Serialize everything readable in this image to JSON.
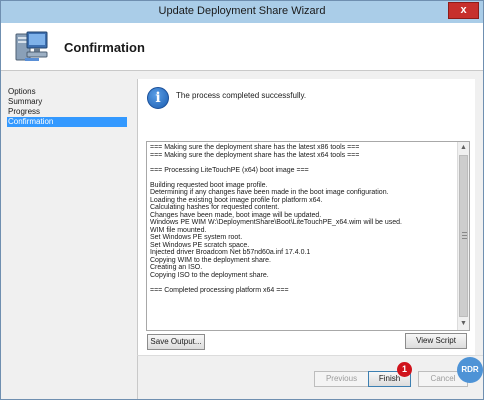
{
  "window": {
    "title": "Update Deployment Share Wizard",
    "close_label": "x"
  },
  "header": {
    "title": "Confirmation",
    "icon": "computer-wizard-icon"
  },
  "sidebar": {
    "items": [
      {
        "label": "Options",
        "active": false
      },
      {
        "label": "Summary",
        "active": false
      },
      {
        "label": "Progress",
        "active": false
      },
      {
        "label": "Confirmation",
        "active": true
      }
    ]
  },
  "content": {
    "info_icon_glyph": "i",
    "success_message": "The process completed successfully.",
    "log_lines": [
      "=== Making sure the deployment share has the latest x86 tools ===",
      "=== Making sure the deployment share has the latest x64 tools ===",
      "",
      "=== Processing LiteTouchPE (x64) boot image ===",
      "",
      "Building requested boot image profile.",
      "Determining if any changes have been made in the boot image configuration.",
      "Loading the existing boot image profile for platform x64.",
      "Calculating hashes for requested content.",
      "Changes have been made, boot image will be updated.",
      "Windows PE WIM W:\\DeploymentShare\\Boot\\LiteTouchPE_x64.wim will be used.",
      "WIM file mounted.",
      "Set Windows PE system root.",
      "Set Windows PE scratch space.",
      "Injected driver Broadcom Net b57nd60a.inf 17.4.0.1",
      "Copying WIM to the deployment share.",
      "Creating an ISO.",
      "Copying ISO to the deployment share.",
      "",
      "=== Completed processing platform x64 ===",
      ""
    ],
    "save_output_label": "Save Output...",
    "view_script_label": "View Script"
  },
  "footer": {
    "previous_label": "Previous",
    "finish_label": "Finish",
    "cancel_label": "Cancel"
  },
  "annotation": {
    "badge": "1",
    "logo": "RDR"
  },
  "colors": {
    "titlebar": "#aacde8",
    "close": "#c7302c",
    "selection": "#3399ff",
    "badge": "#d0131c"
  }
}
